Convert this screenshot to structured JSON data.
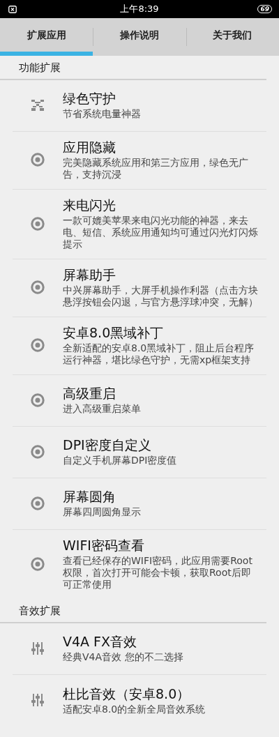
{
  "status_bar": {
    "time": "上午8:39",
    "battery": "69"
  },
  "tabs": [
    {
      "label": "扩展应用",
      "selected": true
    },
    {
      "label": "操作说明",
      "selected": false
    },
    {
      "label": "关于我们",
      "selected": false
    }
  ],
  "sections": [
    {
      "title": "功能扩展",
      "items": [
        {
          "kind": "guard",
          "title": "绿色守护",
          "description": "节省系统电量神器"
        },
        {
          "kind": "target",
          "title": "应用隐藏",
          "description": "完美隐藏系统应用和第三方应用，绿色无广告，支持沉浸"
        },
        {
          "kind": "target",
          "title": "来电闪光",
          "description": "一款可媲美苹果来电闪光功能的神器，来去电、短信、系统应用通知均可通过闪光灯闪烁提示"
        },
        {
          "kind": "target",
          "title": "屏幕助手",
          "description": "中兴屏幕助手，大屏手机操作利器（点击方块悬浮按钮会闪退，与官方悬浮球冲突，无解）"
        },
        {
          "kind": "target",
          "title": "安卓8.0黑域补丁",
          "description": "全新适配的安卓8.0黑域补丁，阻止后台程序运行神器，堪比绿色守护，无需xp框架支持"
        },
        {
          "kind": "target",
          "title": "高级重启",
          "description": "进入高级重启菜单"
        },
        {
          "kind": "target",
          "title": "DPI密度自定义",
          "description": "自定义手机屏幕DPI密度值"
        },
        {
          "kind": "target",
          "title": "屏幕圆角",
          "description": "屏幕四周圆角显示"
        },
        {
          "kind": "target",
          "title": "WIFI密码查看",
          "description": "查看已经保存的WIFI密码，此应用需要Root权限，首次打开可能会卡顿，获取Root后即可正常使用"
        }
      ]
    },
    {
      "title": "音效扩展",
      "items": [
        {
          "kind": "equalizer",
          "title": "V4A FX音效",
          "description": "经典V4A音效 您的不二选择"
        },
        {
          "kind": "equalizer",
          "title": "杜比音效（安卓8.0）",
          "description": "适配安卓8.0的全新全局音效系统"
        }
      ]
    }
  ]
}
